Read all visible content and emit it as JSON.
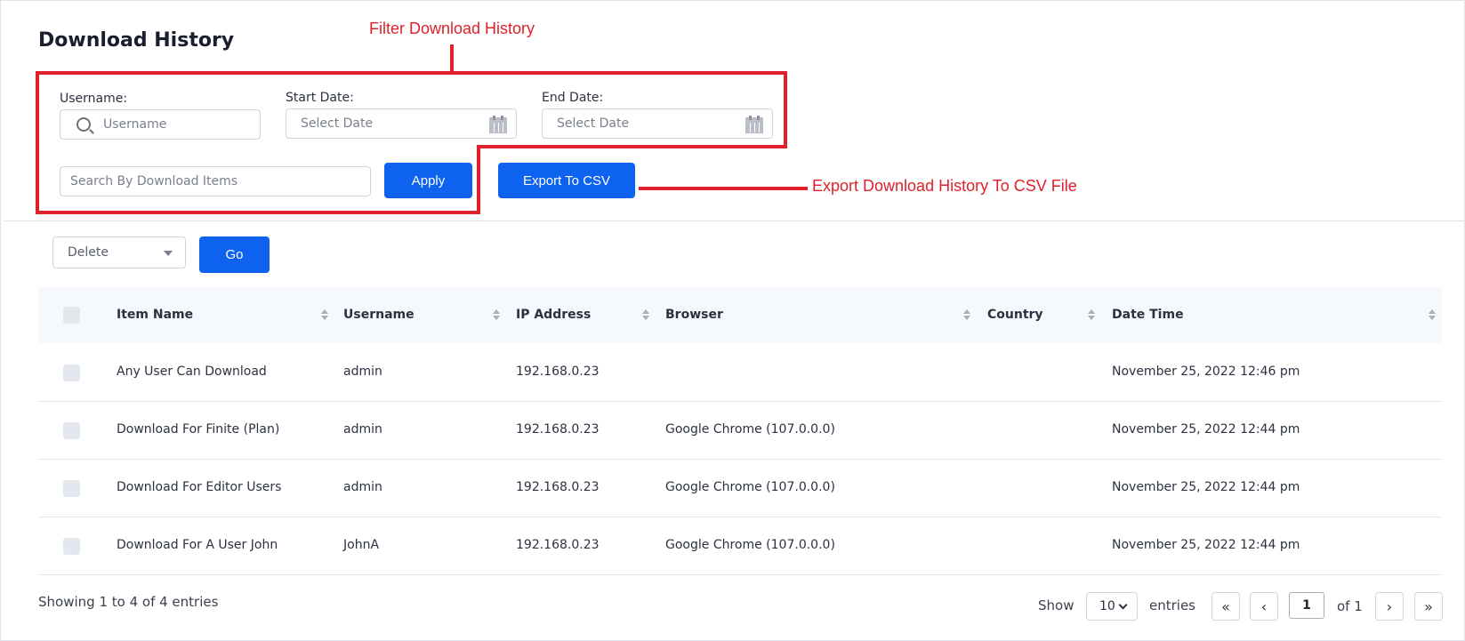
{
  "header": {
    "title": "Download History"
  },
  "annotations": {
    "filter": "Filter Download History",
    "export": "Export Download History To CSV File"
  },
  "filters": {
    "username_label": "Username:",
    "username_placeholder": "Username",
    "start_label": "Start Date:",
    "start_placeholder": "Select Date",
    "end_label": "End Date:",
    "end_placeholder": "Select Date",
    "items_placeholder": "Search By Download Items",
    "apply_label": "Apply",
    "export_label": "Export To CSV"
  },
  "bulk": {
    "action": "Delete",
    "go_label": "Go"
  },
  "table": {
    "columns": [
      "Item Name",
      "Username",
      "IP Address",
      "Browser",
      "Country",
      "Date Time"
    ],
    "rows": [
      {
        "item": "Any User Can Download",
        "user": "admin",
        "ip": "192.168.0.23",
        "browser": "",
        "country": "",
        "datetime": "November 25, 2022 12:46 pm"
      },
      {
        "item": "Download For Finite (Plan)",
        "user": "admin",
        "ip": "192.168.0.23",
        "browser": "Google Chrome (107.0.0.0)",
        "country": "",
        "datetime": "November 25, 2022 12:44 pm"
      },
      {
        "item": "Download For Editor Users",
        "user": "admin",
        "ip": "192.168.0.23",
        "browser": "Google Chrome (107.0.0.0)",
        "country": "",
        "datetime": "November 25, 2022 12:44 pm"
      },
      {
        "item": "Download For A User John",
        "user": "JohnA",
        "ip": "192.168.0.23",
        "browser": "Google Chrome (107.0.0.0)",
        "country": "",
        "datetime": "November 25, 2022 12:44 pm"
      }
    ]
  },
  "footer": {
    "summary": "Showing 1 to 4 of 4 entries",
    "show_label": "Show",
    "per_page": "10",
    "entries_label": "entries",
    "first": "«",
    "prev": "‹",
    "current_page": "1",
    "of_label": "of 1",
    "next": "›",
    "last": "»"
  },
  "colors": {
    "primary": "#0d62f0",
    "annotation": "#e0202a",
    "header_bg": "#f5f8fc"
  }
}
